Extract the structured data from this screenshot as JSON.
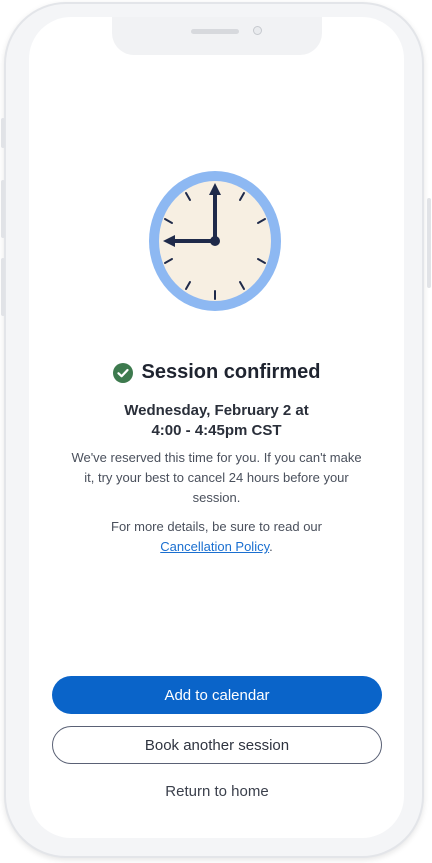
{
  "confirmation": {
    "title": "Session confirmed",
    "datetime_line1": "Wednesday, February 2 at",
    "datetime_line2": "4:00 - 4:45pm CST",
    "description": "We've reserved this time for you. If you can't make it, try your best to cancel 24 hours before your session.",
    "details_prefix": "For more details, be sure to read our",
    "policy_link": "Cancellation Policy",
    "details_suffix": "."
  },
  "actions": {
    "primary_label": "Add to calendar",
    "secondary_label": "Book another session",
    "tertiary_label": "Return to home"
  },
  "icons": {
    "status": "check-circle-icon",
    "illustration": "clock-icon"
  },
  "colors": {
    "primary": "#0a64c9",
    "success": "#3d7a4e",
    "clock_ring": "#8db8f2",
    "clock_face": "#f7efe2",
    "clock_hands": "#1f2a4a",
    "link": "#1a6fd0"
  }
}
